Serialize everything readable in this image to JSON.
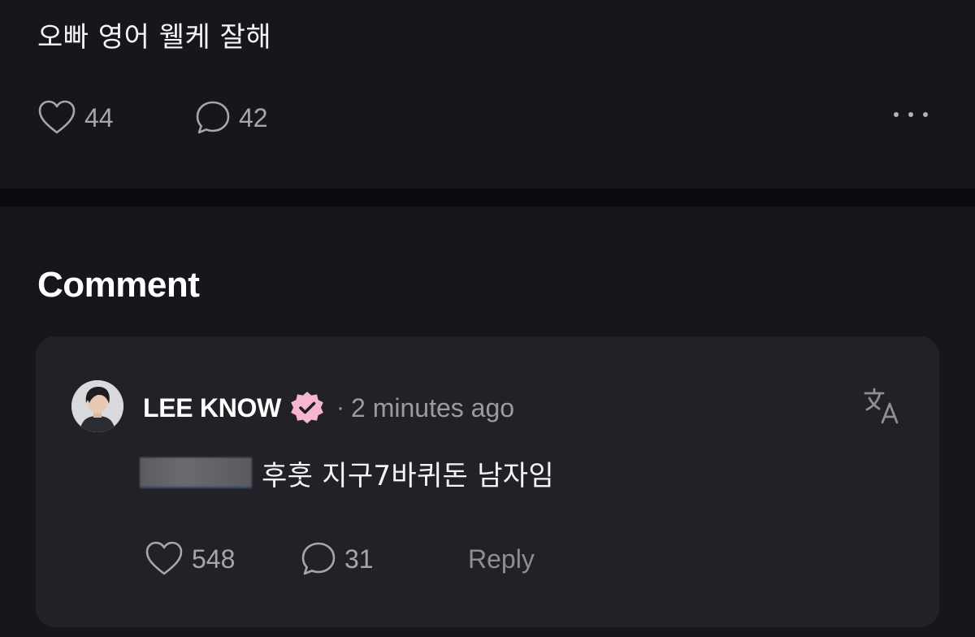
{
  "post": {
    "text": "오빠 영어 웰케 잘해",
    "like_count": "44",
    "comment_count": "42"
  },
  "comments_section": {
    "heading": "Comment",
    "comment": {
      "author": "LEE KNOW",
      "separator": "·",
      "time": "2 minutes ago",
      "text": "후훗 지구7바퀴돈 남자임",
      "like_count": "548",
      "reply_count": "31",
      "reply_label": "Reply"
    }
  },
  "icons": {
    "like": "heart-icon",
    "comment": "comment-bubble-icon",
    "more": "more-horizontal-icon",
    "verified": "verified-badge-icon",
    "translate": "translate-icon"
  },
  "colors": {
    "background": "#17161c",
    "card": "#222128",
    "divider": "#0b0a0e",
    "verified_badge": "#f7b6cf",
    "muted_text": "#9c9ba2"
  }
}
